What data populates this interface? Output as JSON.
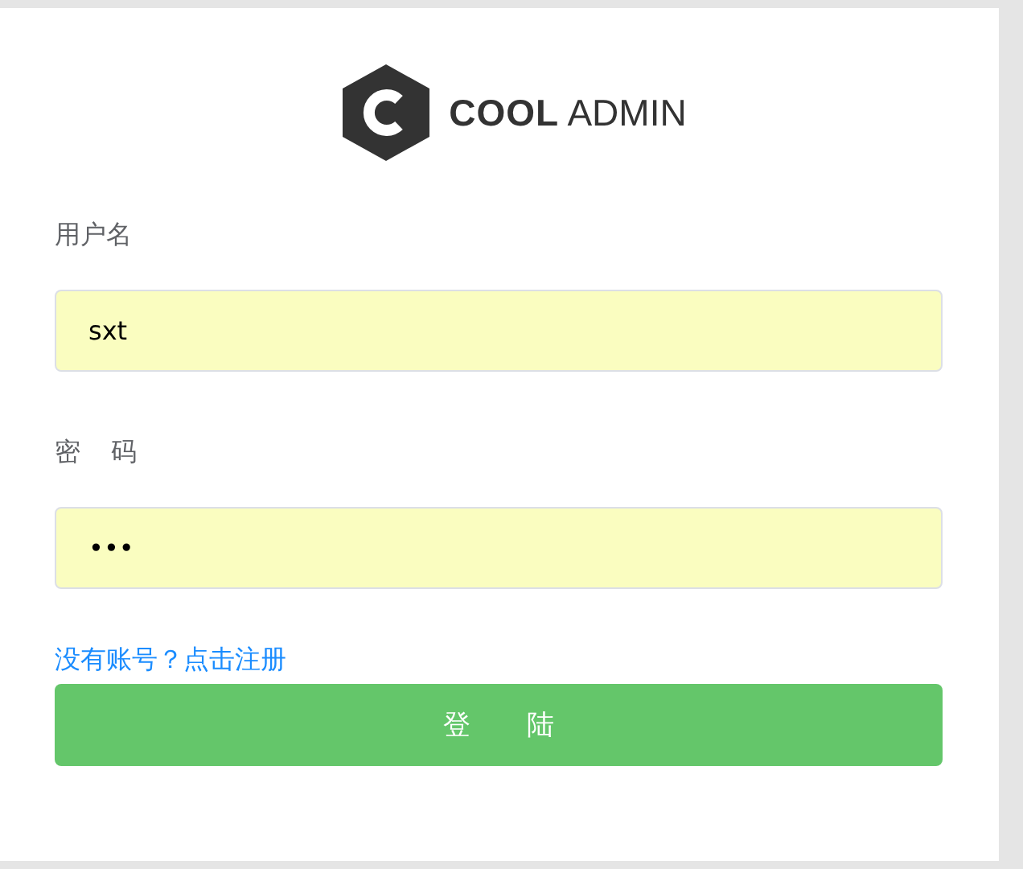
{
  "logo": {
    "bold": "COOL",
    "light": "ADMIN"
  },
  "fields": [
    {
      "label": "用户名",
      "value": "sxt"
    },
    {
      "label": "密 码",
      "value": "•••"
    }
  ],
  "register_link": "没有账号？点击注册",
  "login_button": "登 陆"
}
